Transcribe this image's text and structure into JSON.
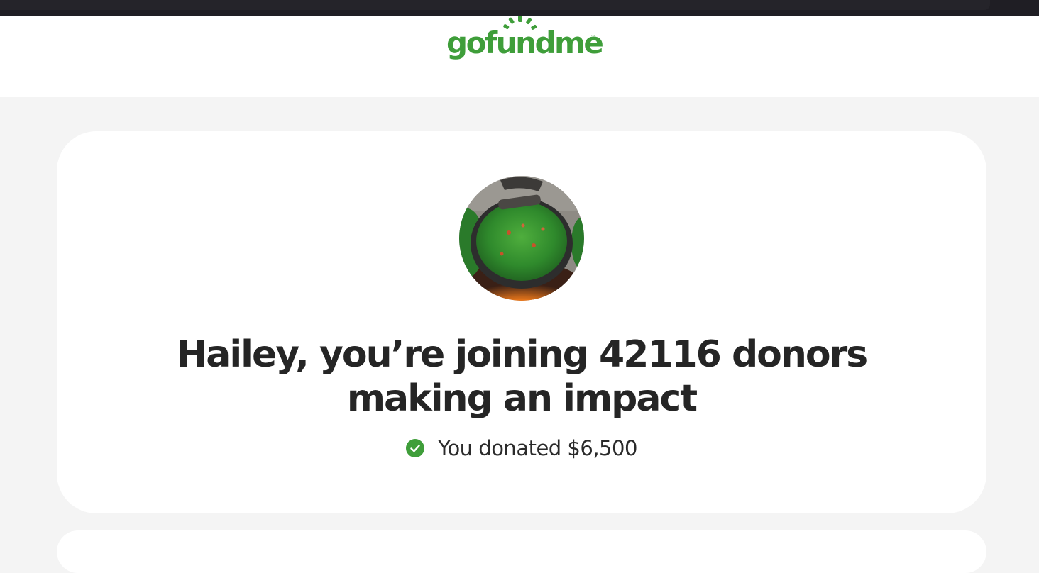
{
  "brand": {
    "logo_text": "gofundme",
    "trademark": "™",
    "logo_color": "#3f9e3a"
  },
  "confirmation": {
    "avatar_icon": "campaign-photo-cooking-pot",
    "headline_line1": "Hailey, you’re joining 42116 donors",
    "headline_line2": "making an impact",
    "donation_status_icon": "check-circle-icon",
    "donation_text": "You donated $6,500",
    "accent_color": "#3f9e3a"
  }
}
